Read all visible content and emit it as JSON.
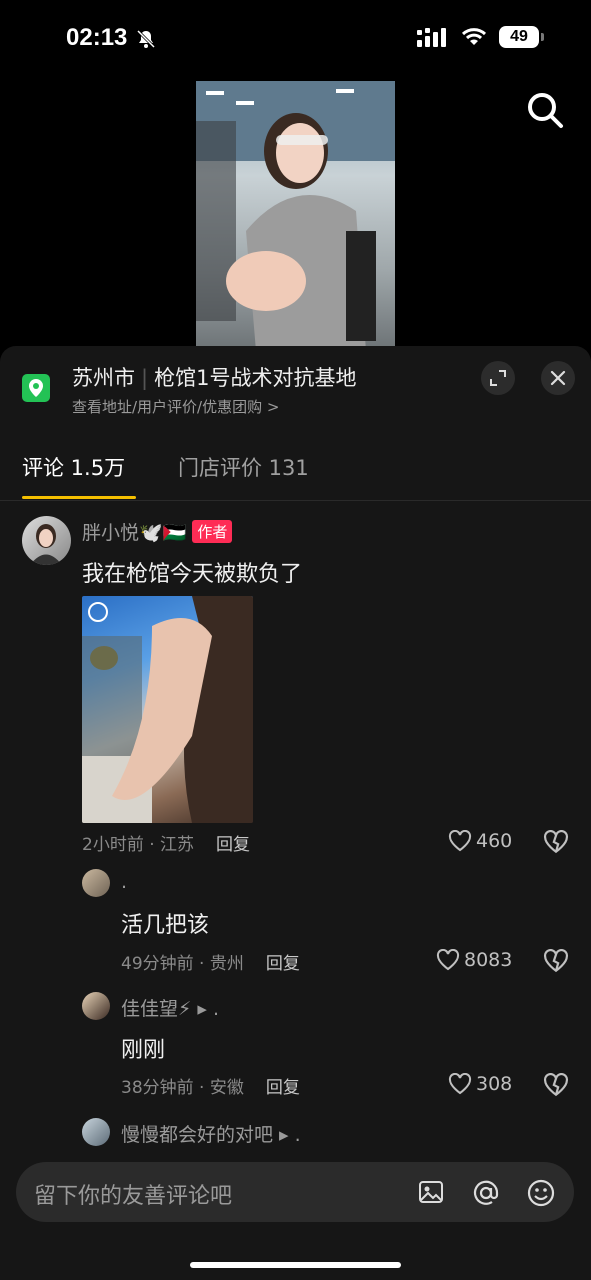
{
  "status_bar": {
    "time": "02:13",
    "battery": "49"
  },
  "location": {
    "city": "苏州市",
    "venue": "枪馆1号战术对抗基地",
    "subtitle": "查看地址/用户评价/优惠团购 >"
  },
  "tabs": [
    {
      "label": "评论 1.5万",
      "active": true
    },
    {
      "label": "门店评价 131",
      "active": false
    }
  ],
  "comments": [
    {
      "username": "胖小悦🕊️🇵🇸",
      "badge": "作者",
      "text": "我在枪馆今天被欺负了",
      "meta": "2小时前 · 江苏",
      "reply_label": "回复",
      "likes": "460"
    }
  ],
  "replies": [
    {
      "username": ".",
      "text": "活几把该",
      "meta": "49分钟前 · 贵州",
      "reply_label": "回复",
      "likes": "8083"
    },
    {
      "username": "佳佳望⚡ ▸ .",
      "text": "刚刚",
      "meta": "38分钟前 · 安徽",
      "reply_label": "回复",
      "likes": "308"
    },
    {
      "username": "慢慢都会好的对吧 ▸ ."
    }
  ],
  "input": {
    "placeholder": "留下你的友善评论吧"
  },
  "colors": {
    "accent": "#f5c000",
    "author_badge": "#fe2c55",
    "location_icon": "#23c255"
  }
}
